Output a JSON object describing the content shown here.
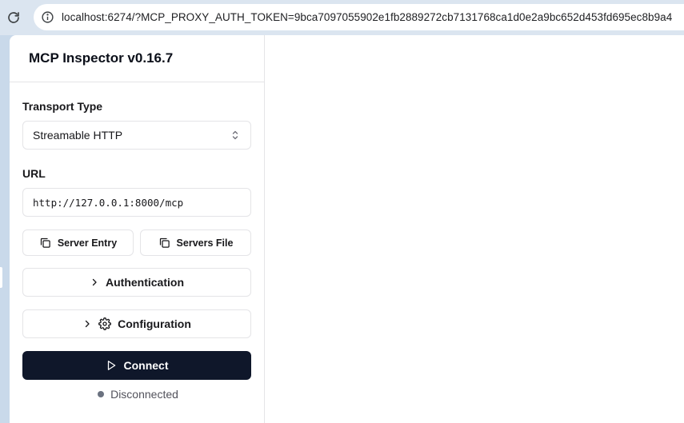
{
  "browser": {
    "url": "localhost:6274/?MCP_PROXY_AUTH_TOKEN=9bca7097055902e1fb2889272cb7131768ca1d0e2a9bc652d453fd695ec8b9a4"
  },
  "sidebar": {
    "title": "MCP Inspector v0.16.7",
    "transport": {
      "label": "Transport Type",
      "selected": "Streamable HTTP"
    },
    "url": {
      "label": "URL",
      "value": "http://127.0.0.1:8000/mcp"
    },
    "buttons": {
      "server_entry": "Server Entry",
      "servers_file": "Servers File",
      "authentication": "Authentication",
      "configuration": "Configuration",
      "connect": "Connect"
    },
    "status": {
      "text": "Disconnected",
      "color": "#6b7280"
    }
  },
  "colors": {
    "connect_bg": "#0f172a",
    "border": "#e4e4e7",
    "browser_chrome": "#dbe5f0"
  },
  "icons": {
    "reload": "reload-icon",
    "site_info": "site-info-icon",
    "select": "chevron-up-down-icon",
    "copy": "copy-icon",
    "chevron": "chevron-right-icon",
    "settings": "gear-icon",
    "play": "play-icon"
  }
}
